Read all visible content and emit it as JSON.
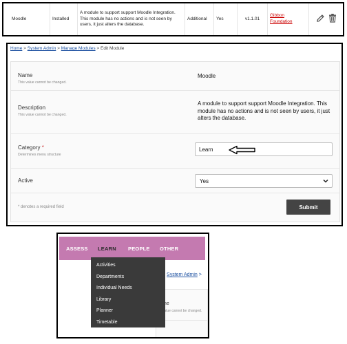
{
  "module_row": {
    "name": "Moodle",
    "status": "Installed",
    "description": "A module to support support Moodle Integration. This module has no actions and is not seen by users, it just alters the database.",
    "type": "Additional",
    "active": "Yes",
    "version": "v1.1.01",
    "author": "Gibbon Foundation",
    "actions": [
      "edit-icon",
      "delete-icon"
    ]
  },
  "edit_module": {
    "breadcrumb": {
      "home": "Home",
      "system_admin": "System Admin",
      "manage_modules": "Manage Modules",
      "current": "Edit Module",
      "separator": ">"
    },
    "fields": {
      "name": {
        "label": "Name",
        "note": "This value cannot be changed.",
        "value": "Moodle"
      },
      "description": {
        "label": "Description",
        "note": "This value cannot be changed.",
        "value": "A module to support support Moodle Integration. This module has no actions and is not seen by users, it just alters the database."
      },
      "category": {
        "label": "Category",
        "required_mark": "*",
        "note": "Determines menu structure",
        "value": "Learn"
      },
      "active": {
        "label": "Active",
        "value": "Yes"
      }
    },
    "footer_note": "* denotes a required field",
    "submit_label": "Submit"
  },
  "nav_menu": {
    "items": [
      "ASSESS",
      "LEARN",
      "PEOPLE",
      "OTHER"
    ],
    "active_item": "LEARN",
    "dropdown": [
      "Activities",
      "Departments",
      "Individual Needs",
      "Library",
      "Planner",
      "Timetable"
    ],
    "behind": {
      "breadcrumb_sep": ">",
      "breadcrumb_link": "System Admin",
      "breadcrumb_end": ">",
      "label_fragment": "me",
      "note_fragment": "value cannot be changed."
    }
  },
  "colors": {
    "nav_bar": "#c47ab0",
    "dropdown_bg": "#3a3a3a",
    "submit_bg": "#444444",
    "author_link": "#cc0000",
    "breadcrumb_link": "#1a4fa0"
  }
}
